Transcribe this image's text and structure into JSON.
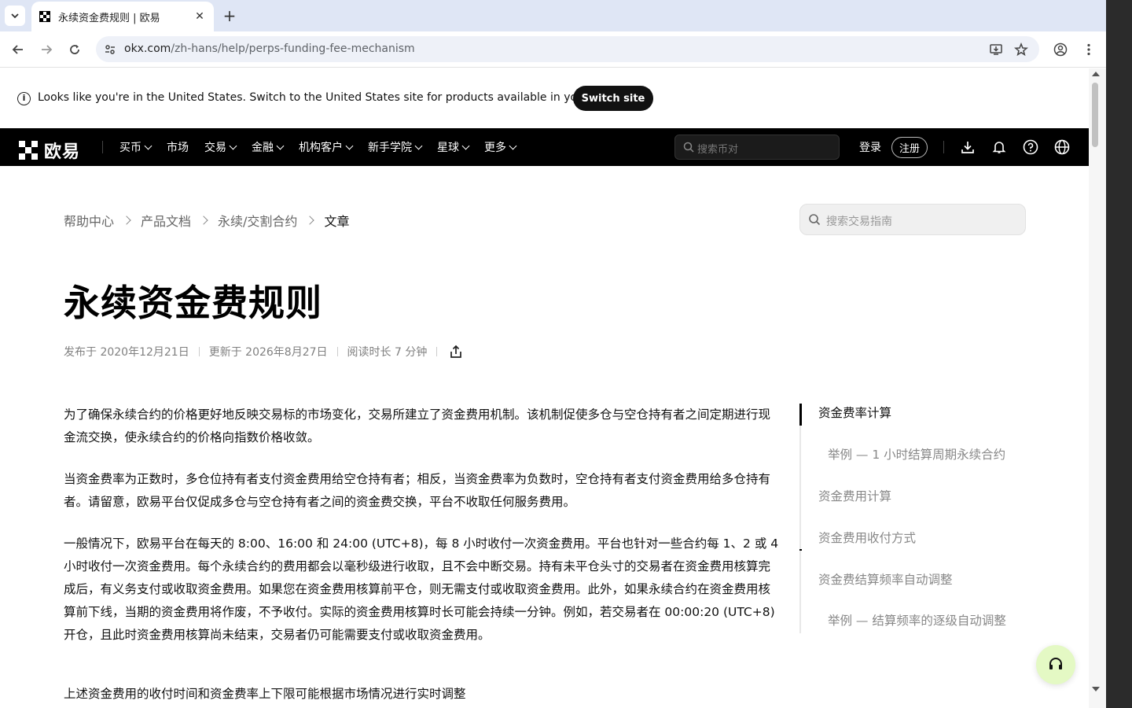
{
  "browser": {
    "tab_title": "永续资金费规则 | 欧易",
    "url_host": "okx.com",
    "url_path": "/zh-hans/help/perps-funding-fee-mechanism"
  },
  "region_banner": {
    "message": "Looks like you're in the United States. Switch to the United States site for products available in your region.",
    "button": "Switch site"
  },
  "nav": {
    "logo_text": "欧易",
    "items": [
      {
        "label": "买币",
        "dropdown": true
      },
      {
        "label": "市场",
        "dropdown": false
      },
      {
        "label": "交易",
        "dropdown": true
      },
      {
        "label": "金融",
        "dropdown": true
      },
      {
        "label": "机构客户",
        "dropdown": true
      },
      {
        "label": "新手学院",
        "dropdown": true
      },
      {
        "label": "星球",
        "dropdown": true
      },
      {
        "label": "更多",
        "dropdown": true
      }
    ],
    "search_placeholder": "搜索币对",
    "login": "登录",
    "register": "注册"
  },
  "breadcrumb": [
    "帮助中心",
    "产品文档",
    "永续/交割合约",
    "文章"
  ],
  "guide_search_placeholder": "搜索交易指南",
  "article": {
    "title": "永续资金费规则",
    "published": "发布于 2020年12月21日",
    "updated": "更新于 2026年8月27日",
    "read_time": "阅读时长 7 分钟",
    "paragraphs": [
      "为了确保永续合约的价格更好地反映交易标的市场变化，交易所建立了资金费用机制。该机制促使多仓与空仓持有者之间定期进行现金流交换，使永续合约的价格向指数价格收敛。",
      "当资金费率为正数时，多仓位持有者支付资金费用给空仓持有者；相反，当资金费率为负数时，空仓持有者支付资金费用给多仓持有者。请留意，欧易平台仅促成多仓与空仓持有者之间的资金费交换，平台不收取任何服务费用。",
      "一般情况下，欧易平台在每天的 8:00、16:00 和 24:00 (UTC+8)，每 8 小时收付一次资金费用。平台也针对一些合约每 1、2 或 4 小时收付一次资金费用。每个永续合约的费用都会以毫秒级进行收取，且不会中断交易。持有未平仓头寸的交易者在资金费用核算完成后，有义务支付或收取资金费用。如果您在资金费用核算前平仓，则无需支付或收取资金费用。此外，如果永续合约在资金费用核算前下线，当期的资金费用将作废，不予收付。实际的资金费用核算时长可能会持续一分钟。例如，若交易者在 00:00:20 (UTC+8) 开仓，且此时资金费用核算尚未结束，交易者仍可能需要支付或收取资金费用。",
      "上述资金费用的收付时间和资金费率上下限可能根据市场情况进行实时调整"
    ]
  },
  "toc": [
    {
      "label": "资金费率计算",
      "level": 1,
      "active": true
    },
    {
      "label": "举例 — 1 小时结算周期永续合约",
      "level": 2,
      "active": false
    },
    {
      "label": "资金费用计算",
      "level": 1,
      "active": false
    },
    {
      "label": "资金费用收付方式",
      "level": 1,
      "active": false
    },
    {
      "label": "资金费结算频率自动调整",
      "level": 1,
      "active": false
    },
    {
      "label": "举例 — 结算频率的逐级自动调整",
      "level": 2,
      "active": false
    }
  ]
}
